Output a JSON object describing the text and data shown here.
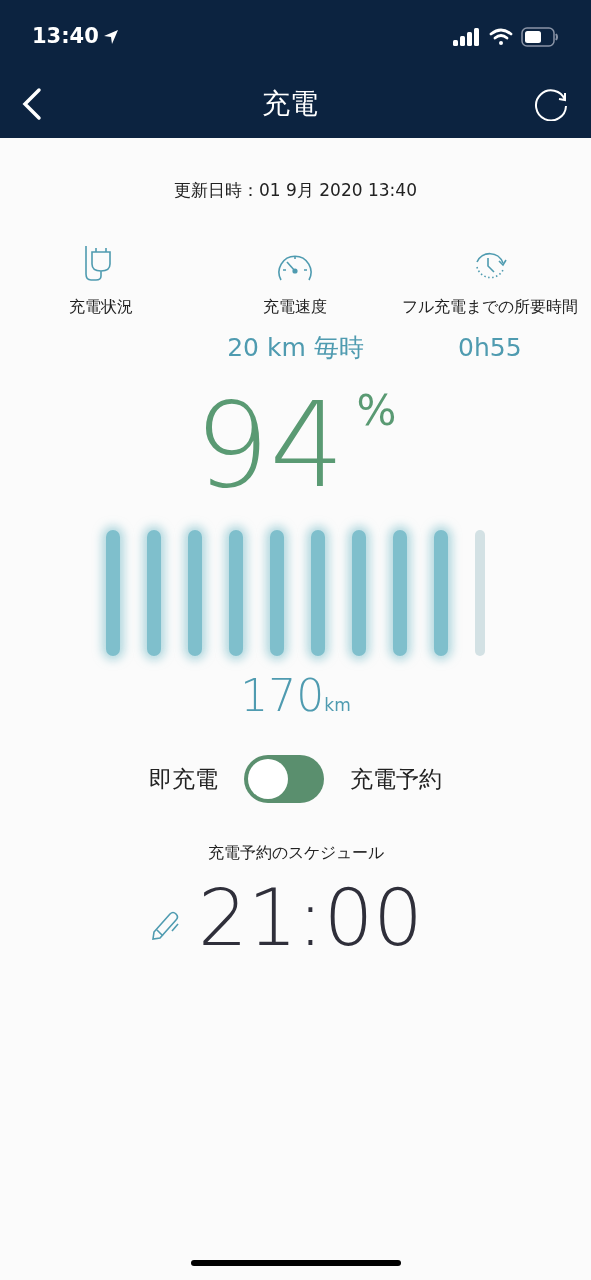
{
  "status_bar": {
    "time": "13:40"
  },
  "header": {
    "title": "充電"
  },
  "updated": "更新日時：01 9月 2020 13:40",
  "stats": [
    {
      "kind": "plug",
      "label": "充電状況"
    },
    {
      "kind": "gauge",
      "label": "充電速度",
      "value": "20 km 毎時"
    },
    {
      "kind": "clock",
      "label": "フル充電までの所要時間",
      "value": "0h55"
    }
  ],
  "battery": {
    "percent": "94",
    "unit": "%",
    "level": 0.9,
    "range": "170",
    "range_unit": "km"
  },
  "mode": {
    "left_label": "即充電",
    "right_label": "充電予約",
    "on": true
  },
  "schedule": {
    "label": "充電予約のスケジュール",
    "time": "21:00"
  }
}
